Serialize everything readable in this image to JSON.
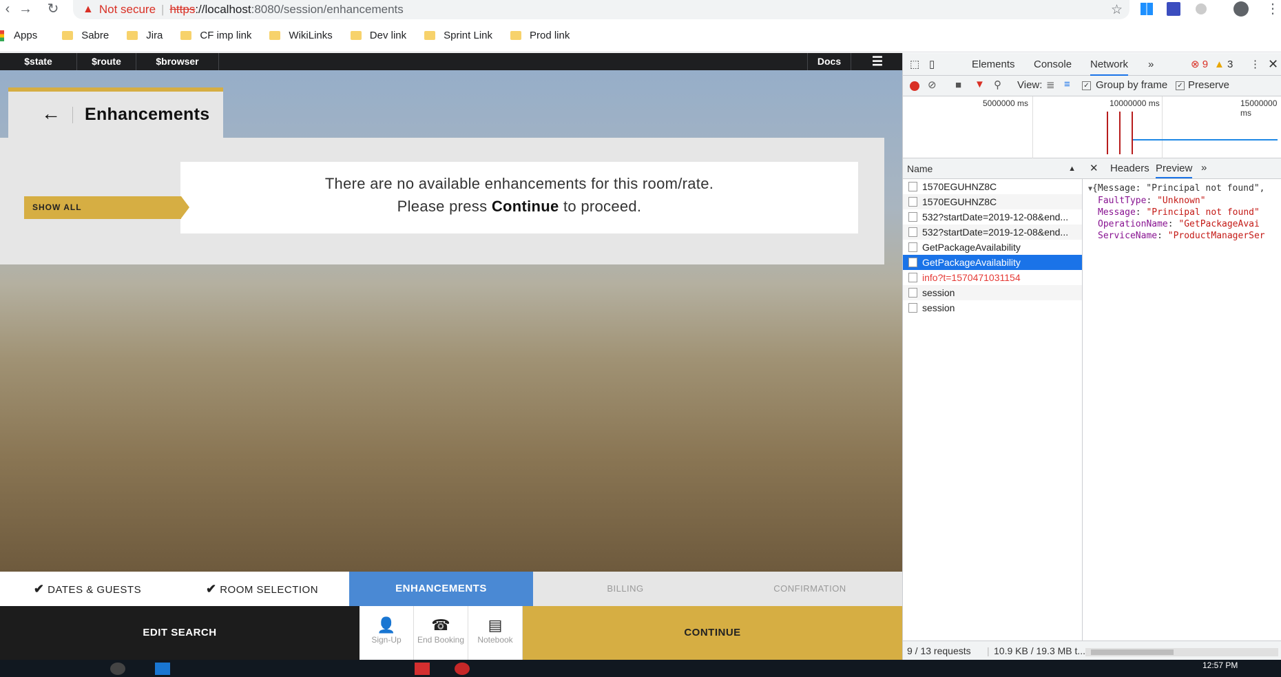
{
  "browser": {
    "security_label": "Not secure",
    "url_scheme": "https",
    "url_host": "://localhost",
    "url_rest": ":8080/session/enhancements",
    "bookmarks": [
      "Apps",
      "Sabre",
      "Jira",
      "CF imp link",
      "WikiLinks",
      "Dev link",
      "Sprint Link",
      "Prod link"
    ]
  },
  "devbar": {
    "items": [
      "$state",
      "$route",
      "$browser"
    ],
    "docs": "Docs"
  },
  "page": {
    "title": "Enhancements",
    "show_all": "SHOW ALL",
    "message_line1": "There are no available enhancements for this room/rate.",
    "message_pre": "Please press",
    "message_bold": "Continue",
    "message_post": "to proceed."
  },
  "steps": [
    {
      "label": "DATES & GUESTS",
      "state": "done"
    },
    {
      "label": "ROOM SELECTION",
      "state": "done"
    },
    {
      "label": "ENHANCEMENTS",
      "state": "active"
    },
    {
      "label": "BILLING",
      "state": "pending"
    },
    {
      "label": "CONFIRMATION",
      "state": "pending"
    }
  ],
  "footer": {
    "edit_search": "EDIT SEARCH",
    "sign_up": "Sign-Up",
    "end_booking": "End Booking",
    "notebook": "Notebook",
    "continue": "CONTINUE"
  },
  "devtools": {
    "tabs": [
      "Elements",
      "Console",
      "Network"
    ],
    "errors": "9",
    "warnings": "3",
    "view_label": "View:",
    "group_by_frame": "Group by frame",
    "preserve": "Preserve",
    "timeline_labels": [
      "5000000 ms",
      "10000000 ms",
      "15000000 ms"
    ],
    "name_header": "Name",
    "requests": [
      {
        "name": "1570EGUHNZ8C",
        "type": "normal"
      },
      {
        "name": "1570EGUHNZ8C",
        "type": "normal"
      },
      {
        "name": "532?startDate=2019-12-08&end...",
        "type": "normal"
      },
      {
        "name": "532?startDate=2019-12-08&end...",
        "type": "normal"
      },
      {
        "name": "GetPackageAvailability",
        "type": "normal"
      },
      {
        "name": "GetPackageAvailability",
        "type": "selected"
      },
      {
        "name": "info?t=1570471031154",
        "type": "error"
      },
      {
        "name": "session",
        "type": "normal"
      },
      {
        "name": "session",
        "type": "normal"
      }
    ],
    "detail_tabs": [
      "Headers",
      "Preview"
    ],
    "preview_summary": "{Message: \"Principal not found\",",
    "preview_fields": [
      {
        "key": "FaultType",
        "value": "\"Unknown\""
      },
      {
        "key": "Message",
        "value": "\"Principal not found\""
      },
      {
        "key": "OperationName",
        "value": "\"GetPackageAvai"
      },
      {
        "key": "ServiceName",
        "value": "\"ProductManagerSer"
      }
    ],
    "status_requests": "9 / 13 requests",
    "status_size": "10.9 KB / 19.3 MB t..."
  },
  "taskbar": {
    "time": "12:57 PM"
  },
  "colors": {
    "accent_gold": "#d6ae43",
    "active_step": "#4a89d4",
    "selected_row": "#1a73e8"
  }
}
